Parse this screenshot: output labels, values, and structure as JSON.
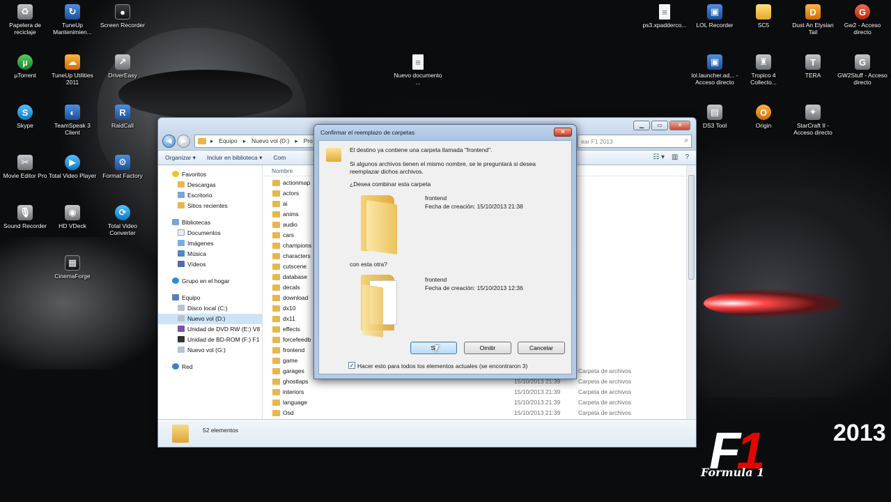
{
  "desktop": {
    "left_icons": [
      {
        "label": "Papelera de reciclaje",
        "icon": "recycle-bin-icon"
      },
      {
        "label": "TuneUp Mantenimien...",
        "icon": "tuneup-icon"
      },
      {
        "label": "Screen Recorder",
        "icon": "screen-recorder-icon"
      },
      {
        "label": "µTorrent",
        "icon": "utorrent-icon"
      },
      {
        "label": "TuneUp Utilities 2011",
        "icon": "tuneup-utilities-icon"
      },
      {
        "label": "DriverEasy",
        "icon": "drivereasy-icon"
      },
      {
        "label": "Skype",
        "icon": "skype-icon"
      },
      {
        "label": "TeamSpeak 3 Client",
        "icon": "teamspeak-icon"
      },
      {
        "label": "RaidCall",
        "icon": "raidcall-icon"
      },
      {
        "label": "Movie Editor Pro",
        "icon": "movie-editor-icon"
      },
      {
        "label": "Total Video Player",
        "icon": "video-player-icon"
      },
      {
        "label": "Format Factory",
        "icon": "format-factory-icon"
      },
      {
        "label": "Sound Recorder",
        "icon": "sound-recorder-icon"
      },
      {
        "label": "HD VDeck",
        "icon": "hd-vdeck-icon"
      },
      {
        "label": "Total Video Converter",
        "icon": "video-converter-icon"
      },
      {
        "label": "CinemaForge",
        "icon": "cinemaforge-icon"
      }
    ],
    "center_icon": {
      "label": "Nuevo documento ...",
      "icon": "text-document-icon"
    },
    "right_icons": [
      {
        "label": "ps3.xpadderco...",
        "icon": "document-icon"
      },
      {
        "label": "LOL Recorder",
        "icon": "lol-recorder-icon"
      },
      {
        "label": "SC5",
        "icon": "folder-icon"
      },
      {
        "label": "Dust An Elysian Tail",
        "icon": "dust-icon"
      },
      {
        "label": "Gw2 - Acceso directo",
        "icon": "gw2-icon"
      },
      {
        "label": "lol.launcher.ad... - Acceso directo",
        "icon": "lol-launcher-icon"
      },
      {
        "label": "Tropico 4 Collecto...",
        "icon": "tropico-icon"
      },
      {
        "label": "TERA",
        "icon": "tera-icon"
      },
      {
        "label": "GW2Stuff - Acceso directo",
        "icon": "gw2stuff-icon"
      },
      {
        "label": "DS3 Tool",
        "icon": "ds3-tool-icon"
      },
      {
        "label": "Origin",
        "icon": "origin-icon"
      },
      {
        "label": "StarCraft II - Acceso directo",
        "icon": "starcraft-icon"
      }
    ],
    "logo": {
      "f": "F",
      "one": "1",
      "year": "2013",
      "sub": "Formula 1"
    }
  },
  "explorer": {
    "breadcrumb": [
      "Equipo",
      "Nuevo vol (D:)",
      "Pro"
    ],
    "search_placeholder": "ear F1 2013",
    "toolbar": {
      "organize": "Organizar ▾",
      "include": "Incluir en biblioteca ▾",
      "share": "Com"
    },
    "column_name": "Nombre",
    "nav": {
      "favorites": "Favoritos",
      "downloads": "Descargas",
      "desktop": "Escritorio",
      "recent": "Sitios recientes",
      "libraries": "Bibliotecas",
      "documents": "Documentos",
      "images": "Imágenes",
      "music": "Música",
      "videos": "Vídeos",
      "homegroup": "Grupo en el hogar",
      "computer": "Equipo",
      "local_disk": "Disco local (C:)",
      "new_vol": "Nuevo vol (D:)",
      "dvd": "Unidad de DVD RW (E:) V8",
      "bd": "Unidad de BD-ROM (F:) F1",
      "new_vol_g": "Nuevo vol (G:)",
      "network": "Red"
    },
    "files": [
      {
        "name": "actionmap",
        "date": "",
        "type": ""
      },
      {
        "name": "actors",
        "date": "",
        "type": ""
      },
      {
        "name": "ai",
        "date": "",
        "type": ""
      },
      {
        "name": "anims",
        "date": "",
        "type": ""
      },
      {
        "name": "audio",
        "date": "",
        "type": ""
      },
      {
        "name": "cars",
        "date": "",
        "type": ""
      },
      {
        "name": "champions",
        "date": "",
        "type": ""
      },
      {
        "name": "characters",
        "date": "",
        "type": ""
      },
      {
        "name": "cutscene",
        "date": "",
        "type": ""
      },
      {
        "name": "database",
        "date": "",
        "type": ""
      },
      {
        "name": "decals",
        "date": "",
        "type": ""
      },
      {
        "name": "download",
        "date": "",
        "type": ""
      },
      {
        "name": "dx10",
        "date": "",
        "type": ""
      },
      {
        "name": "dx11",
        "date": "",
        "type": ""
      },
      {
        "name": "effects",
        "date": "",
        "type": ""
      },
      {
        "name": "forcefeedb",
        "date": "",
        "type": ""
      },
      {
        "name": "frontend",
        "date": "",
        "type": ""
      },
      {
        "name": "game",
        "date": "",
        "type": ""
      },
      {
        "name": "garages",
        "date": "15/10/2013 21:39",
        "type": "Carpeta de archivos"
      },
      {
        "name": "ghostlaps",
        "date": "15/10/2013 21:39",
        "type": "Carpeta de archivos"
      },
      {
        "name": "interiors",
        "date": "15/10/2013 21:39",
        "type": "Carpeta de archivos"
      },
      {
        "name": "language",
        "date": "15/10/2013 21:39",
        "type": "Carpeta de archivos"
      },
      {
        "name": "Osd",
        "date": "15/10/2013 21:39",
        "type": "Carpeta de archivos"
      }
    ],
    "status_count": "52 elementos"
  },
  "dialog": {
    "title": "Confirmar el reemplazo de carpetas",
    "heading": "El destino ya contiene una carpeta llamada \"frontend\".",
    "info_line1": "Si algunos archivos tienen el mismo nombre, se le preguntará si desea",
    "info_line2": "reemplazar dichos archivos.",
    "question": "¿Desea combinar esta carpeta",
    "dest_name": "frontend",
    "dest_date": "Fecha de creación: 15/10/2013 21:38",
    "with_other": "con esta otra?",
    "src_name": "frontend",
    "src_date": "Fecha de creación: 15/10/2013 12:36",
    "btn_yes": "Sí",
    "btn_skip": "Omitir",
    "btn_cancel": "Cancelar",
    "checkbox_label": "Hacer esto para todos los elementos actuales (se encontraron 3)",
    "checkbox_checked": true
  }
}
